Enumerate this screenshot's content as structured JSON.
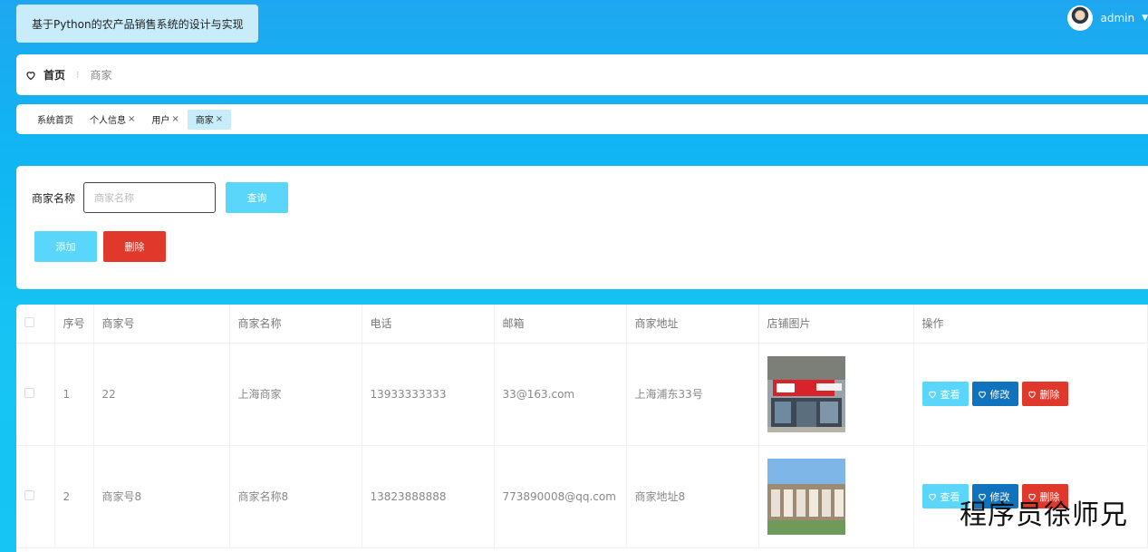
{
  "app_title": "基于Python的农产品销售系统的设计与实现",
  "user": {
    "name": "admin"
  },
  "breadcrumb": {
    "home": "首页",
    "separator": "⁝",
    "current": "商家"
  },
  "tags": [
    {
      "label": "系统首页",
      "closable": false
    },
    {
      "label": "个人信息",
      "closable": true
    },
    {
      "label": "用户",
      "closable": true
    },
    {
      "label": "商家",
      "closable": true,
      "active": true
    }
  ],
  "search": {
    "label": "商家名称",
    "placeholder": "商家名称",
    "query_label": "查询",
    "add_label": "添加",
    "delete_label": "删除"
  },
  "table": {
    "headers": [
      "序号",
      "商家号",
      "商家名称",
      "电话",
      "邮箱",
      "商家地址",
      "店铺图片",
      "操作"
    ],
    "rows": [
      {
        "index": "1",
        "merchant_no": "22",
        "name": "上海商家",
        "phone": "13933333333",
        "email": "33@163.com",
        "address": "上海浦东33号"
      },
      {
        "index": "2",
        "merchant_no": "商家号8",
        "name": "商家名称8",
        "phone": "13823888888",
        "email": "773890008@qq.com",
        "address": "商家地址8"
      }
    ],
    "actions": {
      "view": "查看",
      "edit": "修改",
      "delete": "删除"
    }
  },
  "watermark": "程序员徐师兄",
  "colors": {
    "primary": "#5ad6fa",
    "edit": "#1173bd",
    "danger": "#e0392b"
  }
}
